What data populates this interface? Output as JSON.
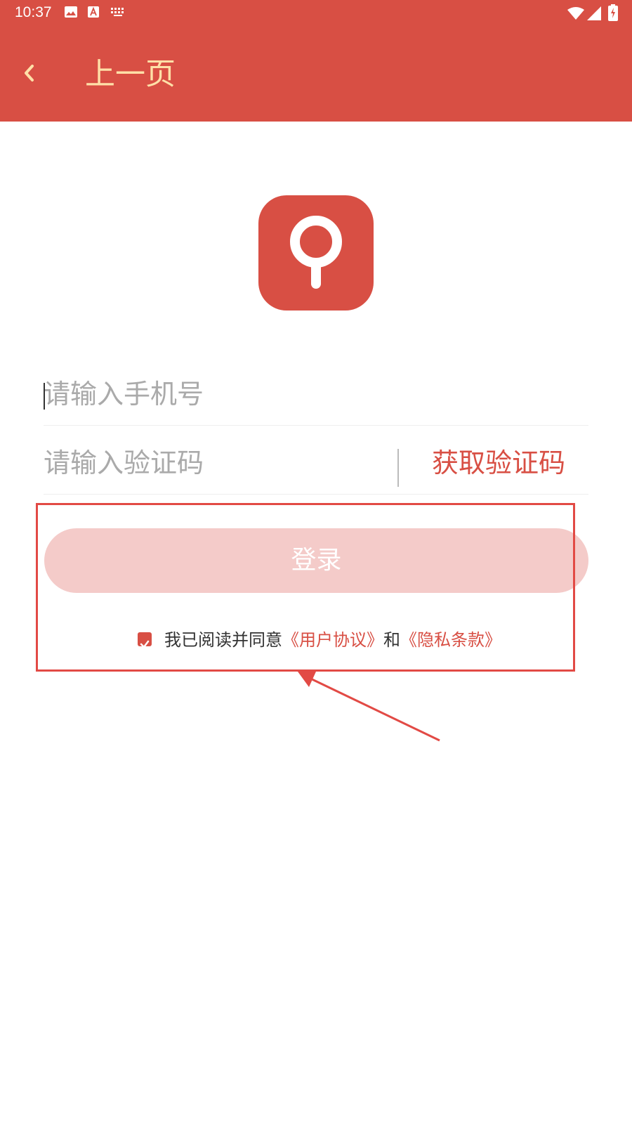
{
  "status_bar": {
    "time": "10:37",
    "icons": [
      "image-icon",
      "text-icon",
      "keyboard-icon",
      "wifi-icon",
      "signal-icon",
      "battery-icon"
    ]
  },
  "toolbar": {
    "back_icon": "chevron-left-icon",
    "title": "上一页"
  },
  "logo": {
    "icon": "search-icon"
  },
  "form": {
    "phone_placeholder": "请输入手机号",
    "phone_value": "",
    "code_placeholder": "请输入验证码",
    "code_value": "",
    "get_code_label": "获取验证码",
    "login_label": "登录"
  },
  "agreement": {
    "checked": true,
    "prefix": "我已阅读并同意",
    "user_agreement": "《用户协议》",
    "conjunction": "和",
    "privacy_policy": "《隐私条款》"
  },
  "colors": {
    "primary": "#d84f44",
    "title_text": "#ffe0a8",
    "login_disabled": "#f4cbc9",
    "annotation": "#e24a45"
  }
}
